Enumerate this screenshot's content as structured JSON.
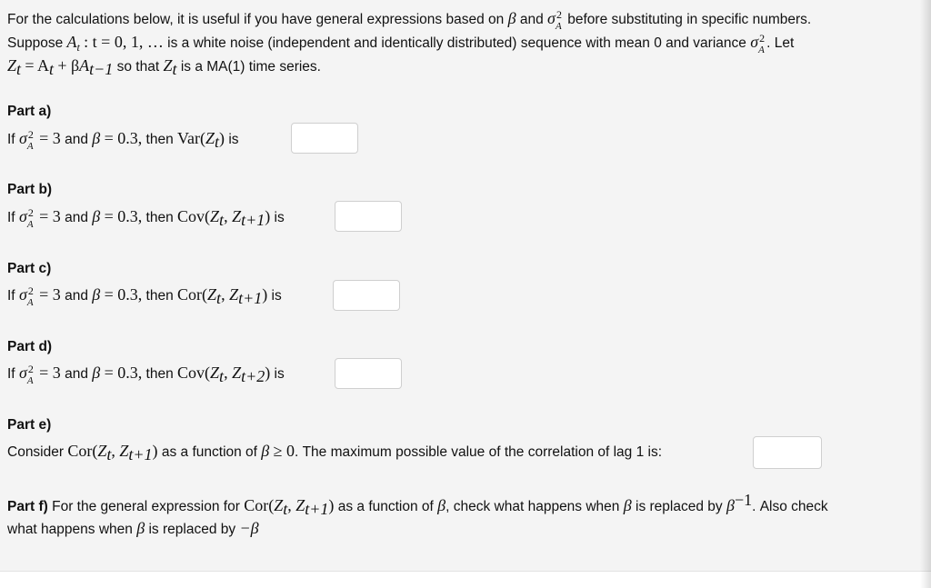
{
  "intro": {
    "line1_pre": "For the calculations below, it is useful if you have general expressions based on",
    "line1_and": "and",
    "line1_post": "before substituting in specific numbers.",
    "line2_pre": "Suppose",
    "line2_seq": ": t = 0, 1, …",
    "line2_mid": "is a white noise (independent and identically distributed) sequence with mean 0 and variance",
    "line2_post": ". Let",
    "line3_eq": "= A",
    "line3_post": "so that",
    "line3_end": "is a MA(1) time series."
  },
  "math": {
    "beta": "β",
    "sigma": "σ",
    "sq": "2",
    "A": "A",
    "Z": "Z",
    "t": "t",
    "tm1": "t−1",
    "tp1": "t+1",
    "tp2": "t+2",
    "eq3": "= 3",
    "eq03": "= 0.3,",
    "plus_beta": "+ β",
    "ge0": "≥ 0",
    "inv": "−1",
    "negbeta": "−β"
  },
  "parts": {
    "a": {
      "title": "Part a)",
      "if": "If",
      "and": "and",
      "then": "then",
      "func": "Var(",
      "close": ")",
      "is": "is",
      "answer": ""
    },
    "b": {
      "title": "Part b)",
      "if": "If",
      "and": "and",
      "then": "then",
      "func": "Cov(",
      "close": ")",
      "is": "is",
      "answer": ""
    },
    "c": {
      "title": "Part c)",
      "if": "If",
      "and": "and",
      "then": "then",
      "func": "Cor(",
      "close": ")",
      "is": "is",
      "answer": ""
    },
    "d": {
      "title": "Part d)",
      "if": "If",
      "and": "and",
      "then": "then",
      "func": "Cov(",
      "close": ")",
      "is": "is",
      "answer": ""
    },
    "e": {
      "title": "Part e)",
      "pre": "Consider",
      "func": "Cor(",
      "close": ")",
      "mid": "as a function of",
      "post": ". The maximum possible value of the correlation of lag 1 is:",
      "answer": ""
    },
    "f": {
      "title": "Part f)",
      "pre": "For the general expression for",
      "func": "Cor(",
      "close": ")",
      "mid": "as a function of",
      "mid2": ", check what happens when",
      "mid3": "is replaced by",
      "post": ". Also check",
      "line2_pre": "what happens when",
      "line2_mid": "is replaced by"
    }
  }
}
